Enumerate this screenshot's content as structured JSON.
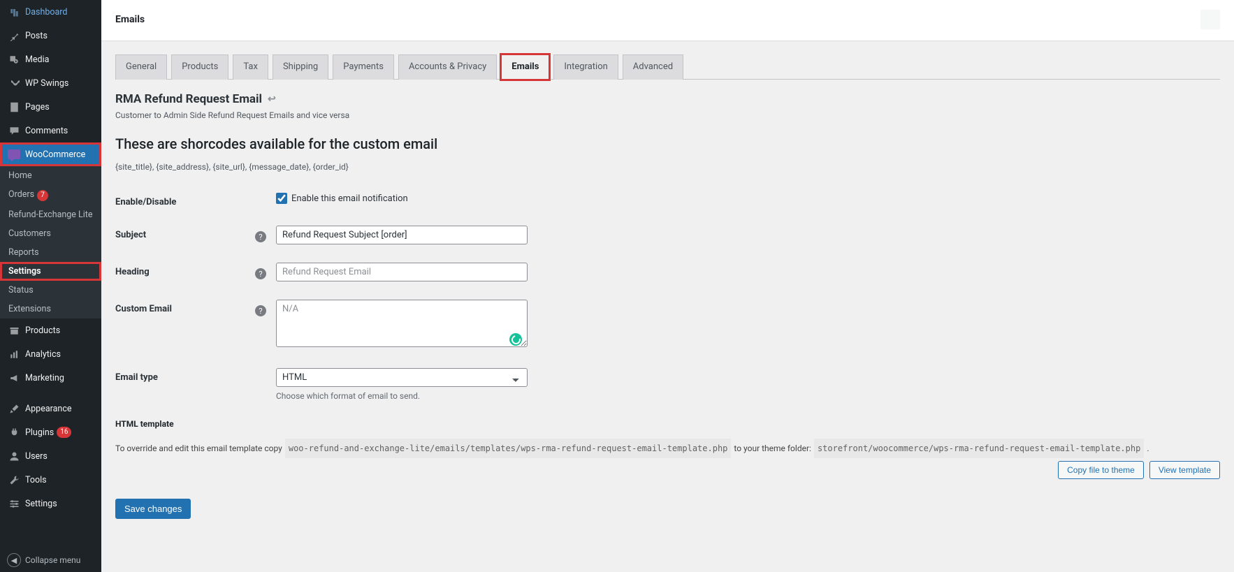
{
  "header": {
    "title": "Emails"
  },
  "sidebar": {
    "items": [
      {
        "label": "Dashboard",
        "icon": "dashboard"
      },
      {
        "label": "Posts",
        "icon": "pin"
      },
      {
        "label": "Media",
        "icon": "media"
      },
      {
        "label": "WP Swings",
        "icon": "wpswings"
      },
      {
        "label": "Pages",
        "icon": "page"
      },
      {
        "label": "Comments",
        "icon": "comment"
      }
    ],
    "woo_label": "WooCommerce",
    "woo_sub": [
      {
        "label": "Home"
      },
      {
        "label": "Orders",
        "badge": "7"
      },
      {
        "label": "Refund-Exchange Lite"
      },
      {
        "label": "Customers"
      },
      {
        "label": "Reports"
      },
      {
        "label": "Settings",
        "current": true
      },
      {
        "label": "Status"
      },
      {
        "label": "Extensions"
      }
    ],
    "lower": [
      {
        "label": "Products",
        "icon": "archive"
      },
      {
        "label": "Analytics",
        "icon": "chart"
      },
      {
        "label": "Marketing",
        "icon": "megaphone"
      },
      {
        "label": "Appearance",
        "icon": "brush"
      },
      {
        "label": "Plugins",
        "icon": "plug",
        "badge": "16"
      },
      {
        "label": "Users",
        "icon": "user"
      },
      {
        "label": "Tools",
        "icon": "wrench"
      },
      {
        "label": "Settings",
        "icon": "sliders"
      }
    ],
    "collapse": "Collapse menu"
  },
  "tabs": [
    {
      "label": "General"
    },
    {
      "label": "Products"
    },
    {
      "label": "Tax"
    },
    {
      "label": "Shipping"
    },
    {
      "label": "Payments"
    },
    {
      "label": "Accounts & Privacy"
    },
    {
      "label": "Emails",
      "active": true
    },
    {
      "label": "Integration"
    },
    {
      "label": "Advanced"
    }
  ],
  "page": {
    "heading": "RMA Refund Request Email",
    "subtitle": "Customer to Admin Side Refund Request Emails and vice versa",
    "shortcodes_heading": "These are shorcodes available for the custom email",
    "shortcodes": "{site_title}, {site_address}, {site_url}, {message_date}, {order_id}"
  },
  "form": {
    "enable_label": "Enable/Disable",
    "enable_checkbox_label": "Enable this email notification",
    "enable_checked": true,
    "subject_label": "Subject",
    "subject_value": "Refund Request Subject [order]",
    "heading_label": "Heading",
    "heading_placeholder": "Refund Request Email",
    "custom_label": "Custom Email",
    "custom_placeholder": "N/A",
    "emailtype_label": "Email type",
    "emailtype_value": "HTML",
    "emailtype_desc": "Choose which format of email to send."
  },
  "template": {
    "heading": "HTML template",
    "pre_text": "To override and edit this email template copy",
    "code1": "woo-refund-and-exchange-lite/emails/templates/wps-rma-refund-request-email-template.php",
    "mid_text": "to your theme folder:",
    "code2": "storefront/woocommerce/wps-rma-refund-request-email-template.php",
    "tail": ".",
    "copy_btn": "Copy file to theme",
    "view_btn": "View template"
  },
  "save_btn": "Save changes"
}
